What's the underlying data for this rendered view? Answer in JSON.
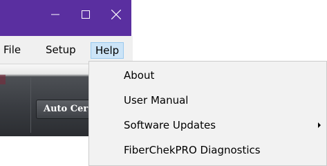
{
  "window": {
    "title_bar_color": "#5a2fa0",
    "controls": {
      "minimize_icon": "minimize-icon",
      "maximize_icon": "maximize-icon",
      "close_icon": "close-icon"
    }
  },
  "menubar": {
    "file": "File",
    "setup": "Setup",
    "help": "Help"
  },
  "toolbar": {
    "auto_button_label": "Auto Cer"
  },
  "help_menu": {
    "items": [
      {
        "label": "About"
      },
      {
        "label": "User Manual"
      },
      {
        "label": "Software Updates",
        "has_submenu": true
      },
      {
        "label": "FiberChekPRO Diagnostics"
      }
    ]
  }
}
